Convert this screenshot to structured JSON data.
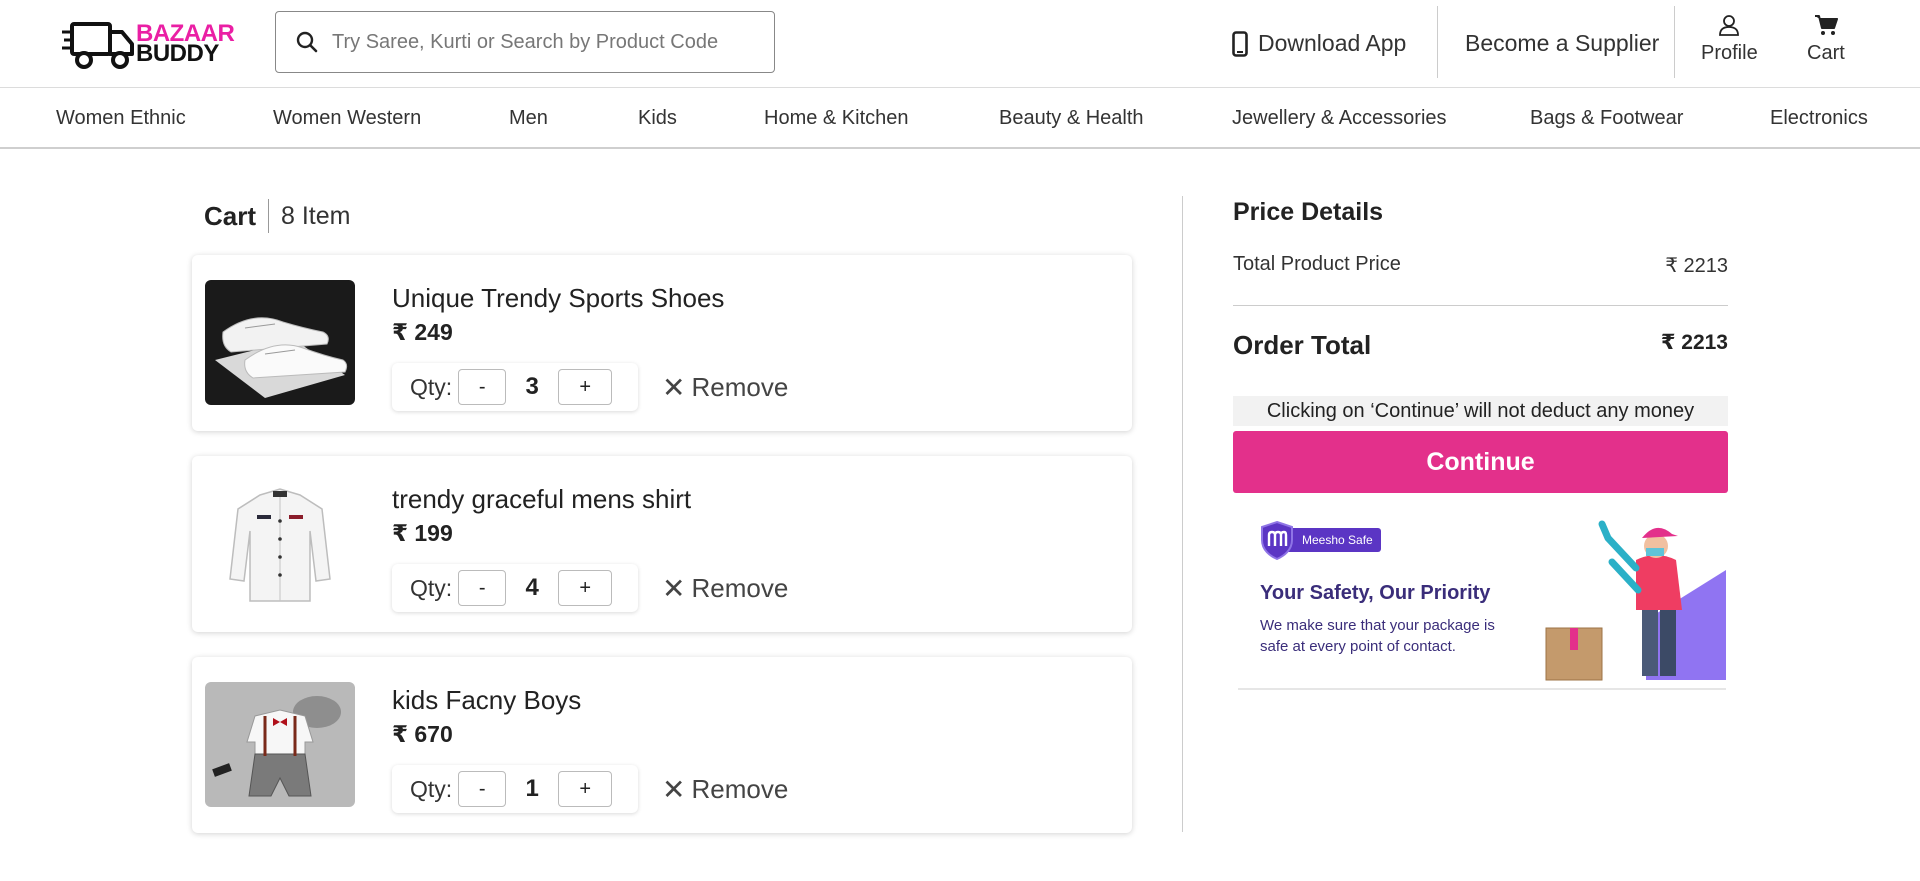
{
  "header": {
    "logo": {
      "line1": "BAZAAR",
      "line2": "BUDDY"
    },
    "search_placeholder": "Try Saree, Kurti or Search by Product Code",
    "download_app": "Download App",
    "become_supplier": "Become a Supplier",
    "profile": "Profile",
    "cart": "Cart"
  },
  "categories": [
    "Women Ethnic",
    "Women Western",
    "Men",
    "Kids",
    "Home & Kitchen",
    "Beauty & Health",
    "Jewellery & Accessories",
    "Bags & Footwear",
    "Electronics"
  ],
  "cart": {
    "title": "Cart",
    "count": "8 Item",
    "qty_label": "Qty:",
    "minus": "-",
    "plus": "+",
    "remove": "Remove",
    "items": [
      {
        "name": "Unique Trendy Sports Shoes",
        "price": "₹ 249",
        "qty": "3",
        "image": "white-sports-shoes"
      },
      {
        "name": "trendy graceful mens shirt",
        "price": "₹ 199",
        "qty": "4",
        "image": "white-mens-shirt"
      },
      {
        "name": "kids Facny Boys",
        "price": "₹ 670",
        "qty": "1",
        "image": "kids-suspender-outfit"
      }
    ]
  },
  "price_details": {
    "title": "Price Details",
    "total_product_price_label": "Total Product Price",
    "total_product_price": "₹ 2213",
    "order_total_label": "Order Total",
    "order_total": "₹ 2213",
    "note": "Clicking on ‘Continue’ will not deduct any money",
    "continue": "Continue"
  },
  "safety_banner": {
    "badge": "Meesho Safe",
    "title": "Your Safety, Our Priority",
    "text": "We make sure that your package is safe at every point of contact."
  },
  "colors": {
    "brand_pink": "#e3308b",
    "logo_pink": "#ea1fa4",
    "banner_purple": "#5b35c4"
  }
}
